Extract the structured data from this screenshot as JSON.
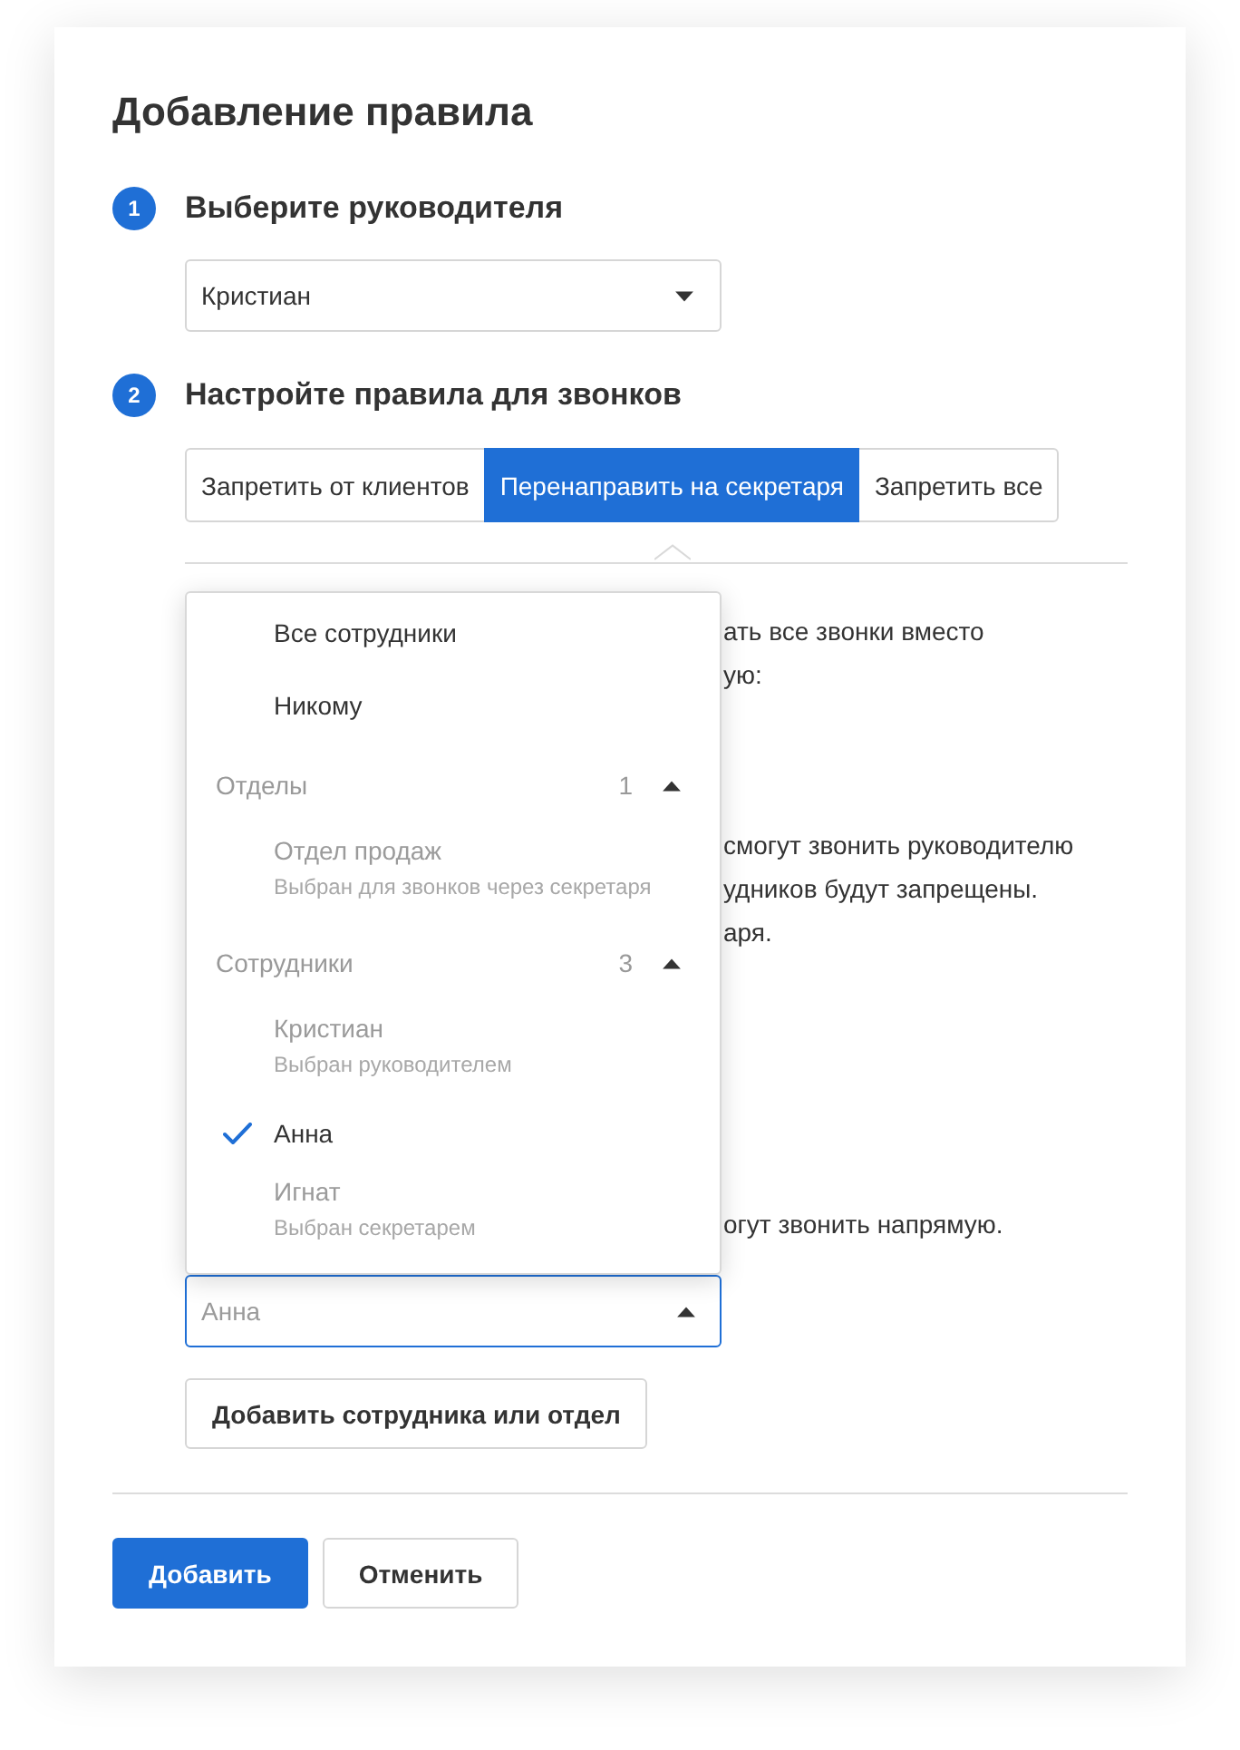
{
  "title": "Добавление правила",
  "step_1": {
    "number": "1",
    "label": "Выберите руководителя",
    "manager_select": {
      "value": "Кристиан",
      "expanded": false
    }
  },
  "step_2": {
    "number": "2",
    "label": "Настройте правила для звонков",
    "tabs": [
      {
        "label": "Запретить от клиентов",
        "selected": false
      },
      {
        "label": "Перенаправить на секретаря",
        "selected": true
      },
      {
        "label": "Запретить все",
        "selected": false
      }
    ],
    "partly_covered_text": [
      {
        "lines": [
          "ать все звонки вместо",
          "ую:"
        ]
      },
      {
        "lines": [
          "смогут звонить руководителю",
          "удников будут запрещены.",
          "аря."
        ]
      },
      {
        "lines": [
          "огут звонить напрямую."
        ]
      }
    ],
    "employee_select": {
      "placeholder": "Анна",
      "expanded": true,
      "options": [
        {
          "kind": "option",
          "label": "Все сотрудники",
          "selected": false,
          "disabled": false
        },
        {
          "kind": "option",
          "label": "Никому",
          "selected": false,
          "disabled": false
        },
        {
          "kind": "group",
          "label": "Отделы",
          "count": "1",
          "expanded": true,
          "children": [
            {
              "label": "Отдел продаж",
              "note": "Выбран для звонков через секретаря",
              "selected": false,
              "disabled": true
            }
          ]
        },
        {
          "kind": "group",
          "label": "Сотрудники",
          "count": "3",
          "expanded": true,
          "children": [
            {
              "label": "Кристиан",
              "note": "Выбран руководителем",
              "selected": false,
              "disabled": true
            },
            {
              "label": "Анна",
              "selected": true,
              "disabled": false
            },
            {
              "label": "Игнат",
              "note": "Выбран секретарем",
              "selected": false,
              "disabled": true
            }
          ]
        }
      ]
    },
    "add_button": {
      "label": "Добавить сотрудника или отдел"
    }
  },
  "actions": [
    {
      "label": "Добавить",
      "kind": "primary"
    },
    {
      "label": "Отменить",
      "kind": "secondary"
    }
  ]
}
